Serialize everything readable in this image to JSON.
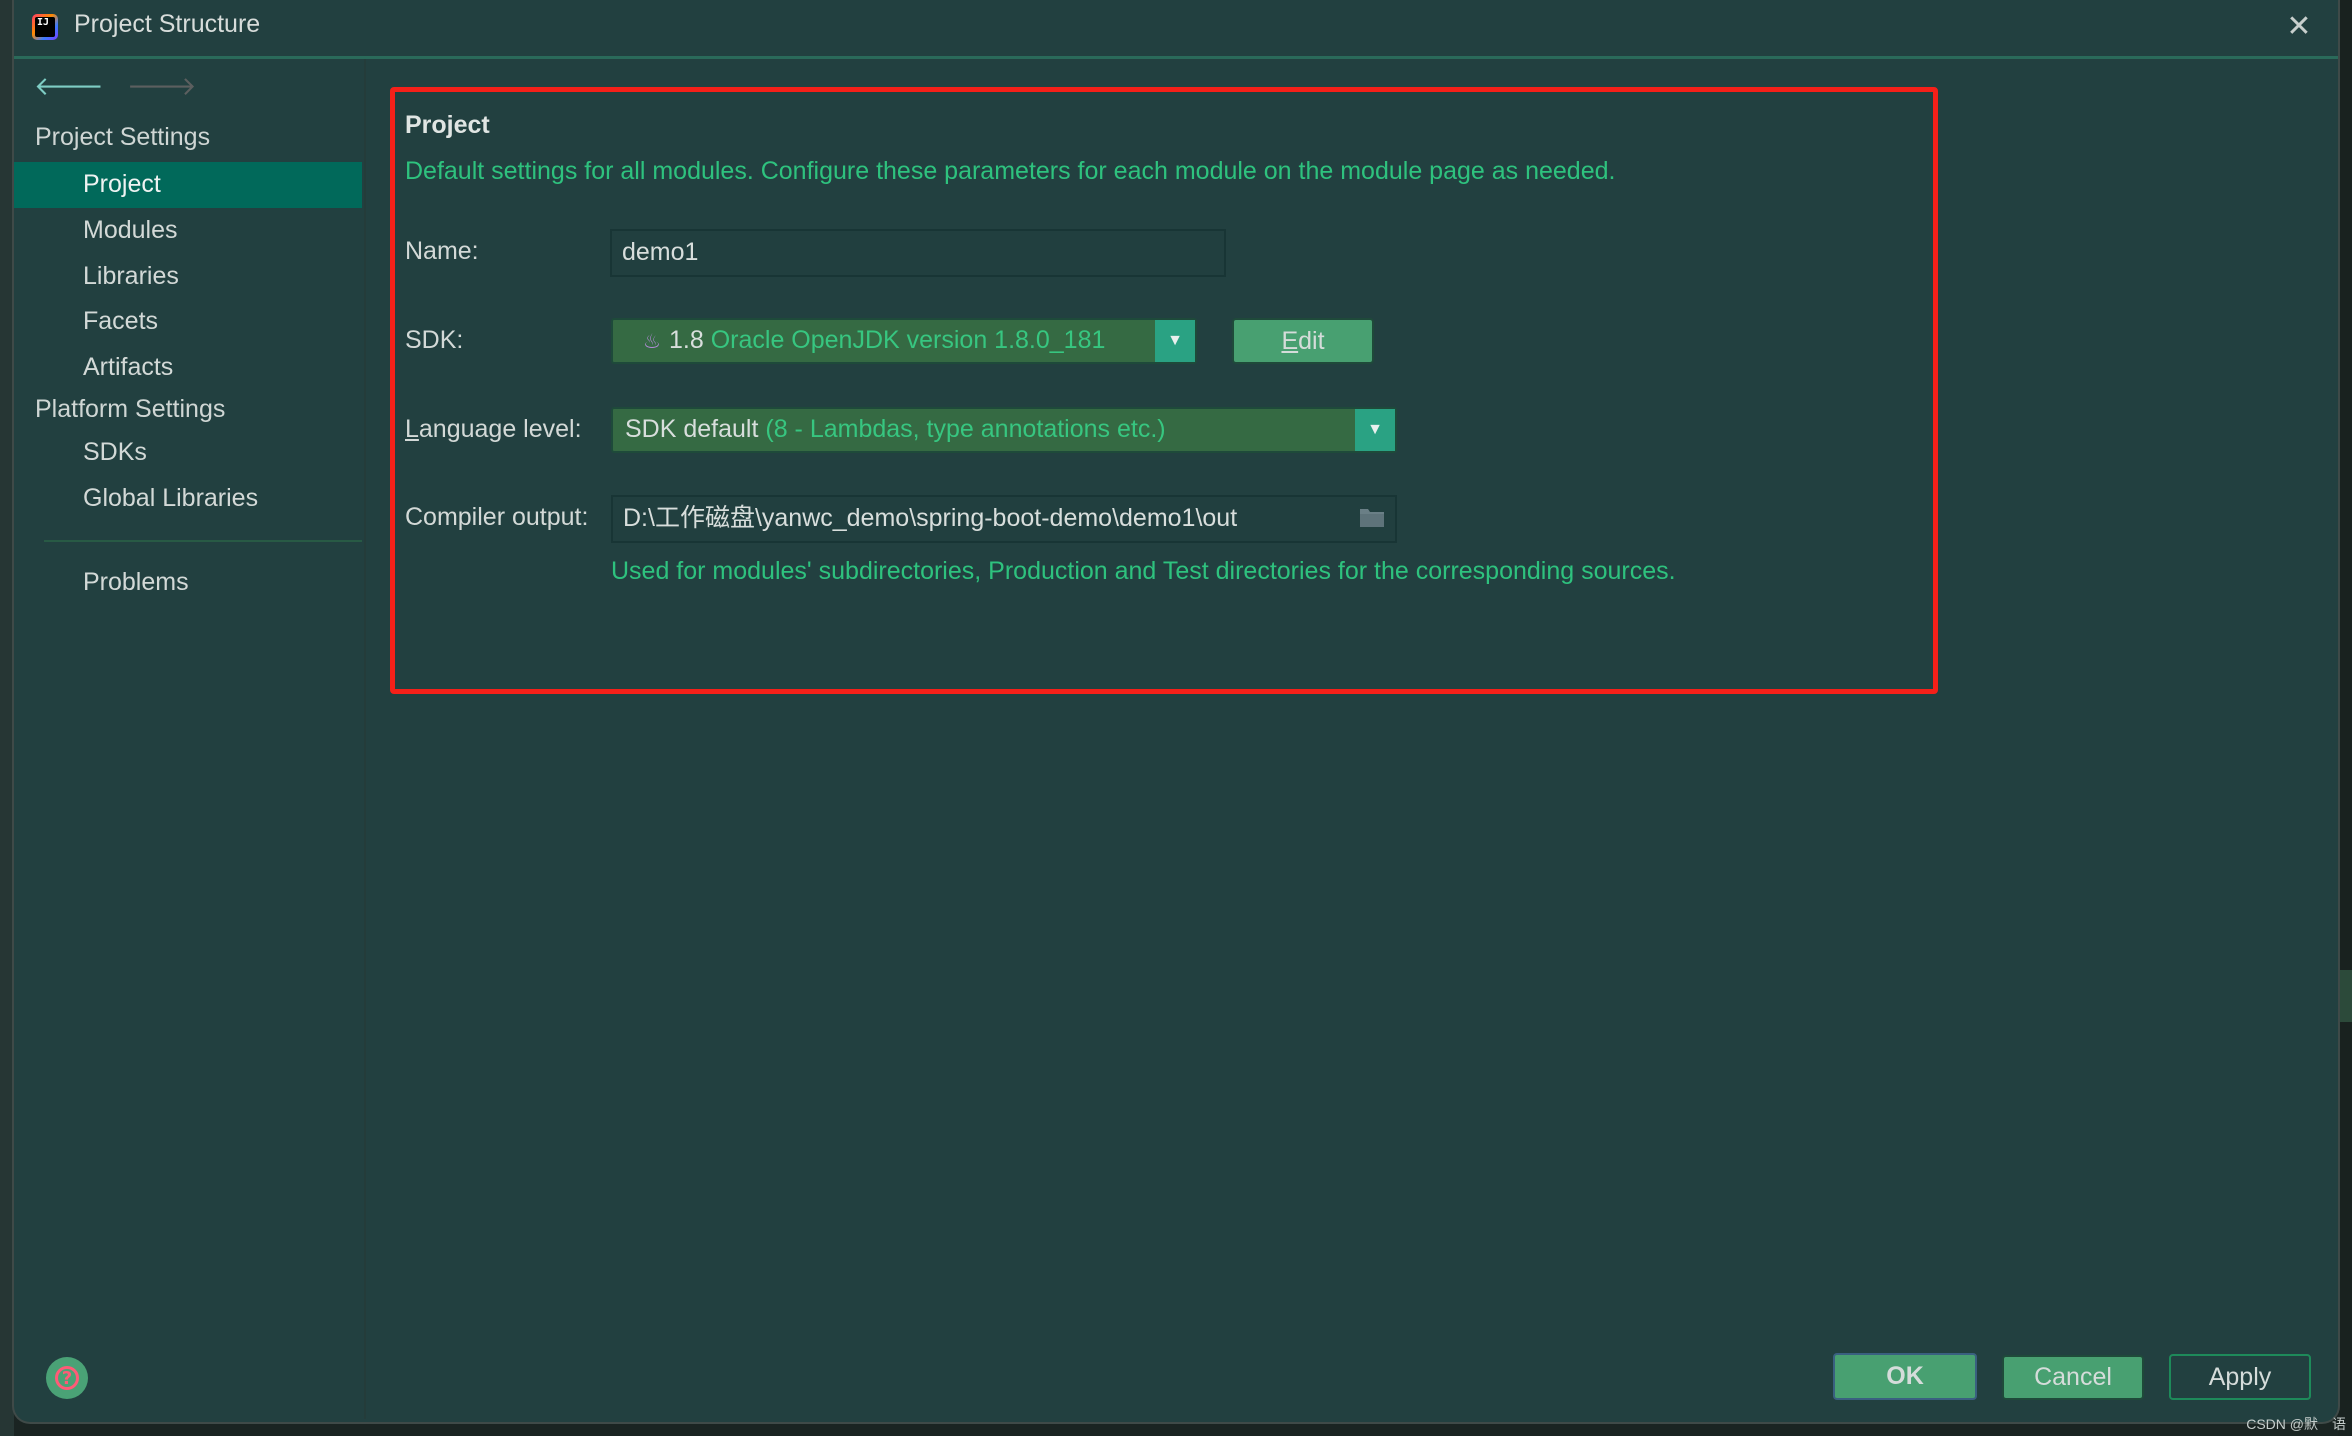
{
  "window": {
    "title": "Project Structure",
    "close_icon": "close-icon",
    "app_icon": "intellij-idea-icon"
  },
  "nav": {
    "back_icon": "arrow-left-icon",
    "forward_icon": "arrow-right-icon"
  },
  "sidebar": {
    "groups": [
      {
        "label": "Project Settings",
        "items": [
          {
            "label": "Project",
            "selected": true
          },
          {
            "label": "Modules",
            "selected": false
          },
          {
            "label": "Libraries",
            "selected": false
          },
          {
            "label": "Facets",
            "selected": false
          },
          {
            "label": "Artifacts",
            "selected": false
          }
        ]
      },
      {
        "label": "Platform Settings",
        "items": [
          {
            "label": "SDKs",
            "selected": false
          },
          {
            "label": "Global Libraries",
            "selected": false
          }
        ]
      }
    ],
    "problems_label": "Problems",
    "help_icon": "help-icon"
  },
  "main": {
    "section_title": "Project",
    "description": "Default settings for all modules. Configure these parameters for each module on the module page as needed.",
    "name": {
      "label": "Name:",
      "value": "demo1"
    },
    "sdk": {
      "label": "SDK:",
      "version": "1.8",
      "detail": "Oracle OpenJDK version 1.8.0_181",
      "edit_label": "Edit",
      "edit_mnemonic": "E",
      "edit_rest": "dit"
    },
    "language_level": {
      "label_mnemonic": "L",
      "label_rest": "anguage level:",
      "value": "SDK default",
      "detail": "(8 - Lambdas, type annotations etc.)"
    },
    "compiler_output": {
      "label": "Compiler output:",
      "value": "D:\\工作磁盘\\yanwc_demo\\spring-boot-demo\\demo1\\out",
      "hint": "Used for modules' subdirectories, Production and Test directories for the corresponding sources."
    }
  },
  "footer": {
    "ok_label": "OK",
    "cancel_label": "Cancel",
    "apply_label": "Apply"
  },
  "watermark": "CSDN @默　语",
  "colors": {
    "background": "#224040",
    "selection": "#01695a",
    "accent_green": "#2ec27e",
    "button_green": "#48a071",
    "highlight_box": "#f52019"
  }
}
